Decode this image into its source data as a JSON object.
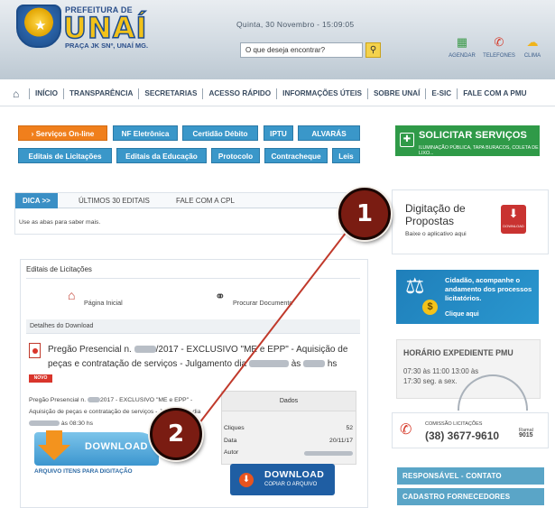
{
  "header": {
    "prefeitura": "PREFEITURA DE",
    "city": "UNAÍ",
    "address": "PRAÇA JK SNº, UNAÍ MG.",
    "datetime": "Quinta, 30 Novembro - 15:09:05",
    "search_placeholder": "O que deseja encontrar?",
    "tools": [
      {
        "label": "AGENDAR",
        "icon": "calendar-icon"
      },
      {
        "label": "TELEFONES",
        "icon": "phone-icon"
      },
      {
        "label": "CLIMA",
        "icon": "weather-icon"
      }
    ]
  },
  "nav": {
    "items": [
      "INÍCIO",
      "TRANSPARÊNCIA",
      "SECRETARIAS",
      "ACESSO RÁPIDO",
      "INFORMAÇÕES ÚTEIS",
      "SOBRE UNAÍ",
      "E-SIC",
      "FALE COM A PMU"
    ]
  },
  "services": {
    "row1": [
      "Serviços On-line",
      "NF Eletrônica",
      "Certidão Débito",
      "IPTU",
      "ALVARÁS"
    ],
    "row2": [
      "Editais de Licitações",
      "Editais da Educação",
      "Protocolo",
      "Contracheque",
      "Leis"
    ]
  },
  "solicitar": {
    "title": "SOLICITAR SERVIÇOS",
    "subtitle": "ILUMINAÇÃO PÚBLICA, TAPA BURACOS, COLETA DE LIXO..."
  },
  "tabs": {
    "items": [
      "DICA >>",
      "ÚLTIMOS 30 EDITAIS",
      "FALE COM A CPL"
    ],
    "hint": "Use as abas para saber mais."
  },
  "digitacao": {
    "title": "Digitação de Propostas",
    "subtitle": "Baixe o aplicativo aqui",
    "icon_label": "DOWNLOAD"
  },
  "panel": {
    "title": "Editais de Licitações",
    "home_link": "Página Inicial",
    "search_link": "Procurar Documento",
    "details_header": "Detalhes do Download",
    "desc_1": "Pregão Presencial n.",
    "desc_2": "/2017 - EXCLUSIVO \"ME e EPP\" - Aquisição de peças e contratação de serviços - Julgamento dia",
    "desc_3": "às",
    "desc_4": "hs",
    "new_badge": "NOVO",
    "small_1": "Pregão Presencial n.",
    "small_2": "2017 - EXCLUSIVO \"ME e EPP\" - Aquisição de peças e contratação de serviços - Julgamento dia",
    "small_3": "às 08:30 hs",
    "dados": {
      "header": "Dados",
      "rows": [
        {
          "key": "Cliques",
          "value": "52"
        },
        {
          "key": "Data",
          "value": "20/11/17"
        },
        {
          "key": "Autor",
          "value": ""
        }
      ]
    },
    "download_label": "DOWNLOAD",
    "arquivo_label": "ARQUIVO ITENS PARA DIGITAÇÃO",
    "download2_title": "DOWNLOAD",
    "download2_sub": "COPIAR O ARQUIVO"
  },
  "cidadao": {
    "text": "Cidadão, acompanhe o andamento dos processos licitatórios.",
    "link": "Clique aqui",
    "coin": "$"
  },
  "horario": {
    "title": "HORÁRIO EXPEDIENTE PMU",
    "body": "07:30 às 11:00 13:00 às 17:30 seg. a sex."
  },
  "contato": {
    "label": "COMISSÃO LICITAÇÕES",
    "phone": "(38) 3677-9610",
    "ramal_label": "Ramal",
    "ramal": "9015"
  },
  "right_links": [
    "RESPONSÁVEL - CONTATO",
    "CADASTRO FORNECEDORES"
  ],
  "annotations": {
    "marker1": "1",
    "marker2": "2",
    "line_color": "#c0392b"
  }
}
